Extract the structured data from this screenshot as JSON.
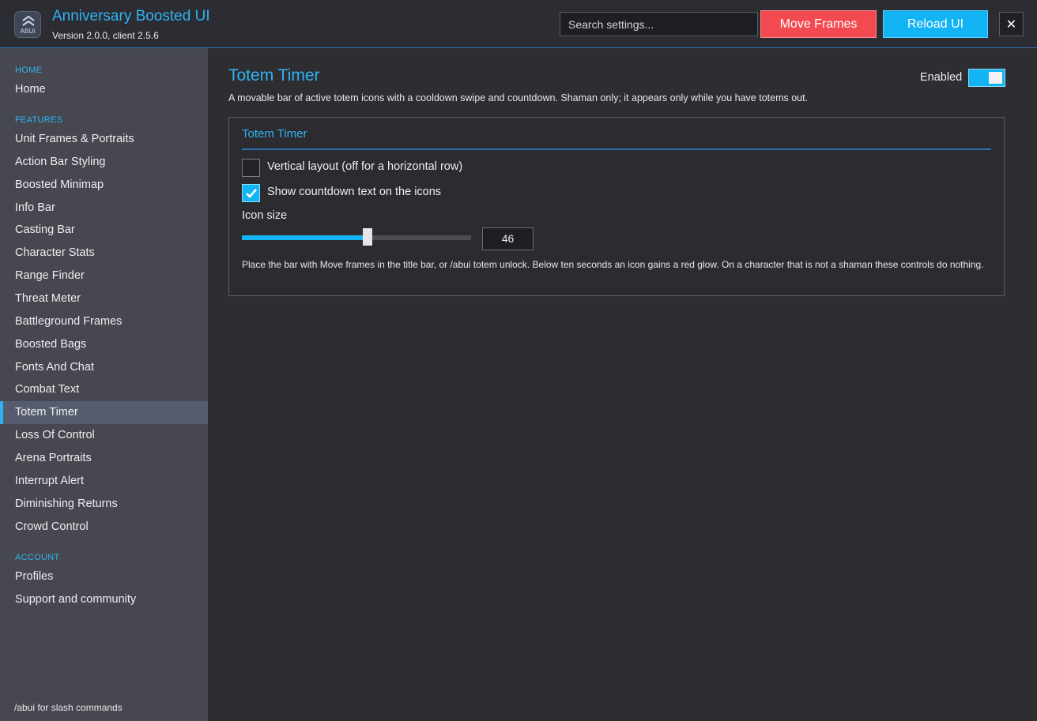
{
  "app": {
    "logo_text": "ABUI",
    "title": "Anniversary Boosted UI",
    "version": "Version 2.0.0, client 2.5.6"
  },
  "header": {
    "search_placeholder": "Search settings...",
    "move_frames_label": "Move Frames",
    "reload_ui_label": "Reload UI",
    "close_label": "✕"
  },
  "sidebar": {
    "sections": [
      {
        "label": "HOME",
        "items": [
          "Home"
        ]
      },
      {
        "label": "FEATURES",
        "items": [
          "Unit Frames & Portraits",
          "Action Bar Styling",
          "Boosted Minimap",
          "Info Bar",
          "Casting Bar",
          "Character Stats",
          "Range Finder",
          "Threat Meter",
          "Battleground Frames",
          "Boosted Bags",
          "Fonts And Chat",
          "Combat Text",
          "Totem Timer",
          "Loss Of Control",
          "Arena Portraits",
          "Interrupt Alert",
          "Diminishing Returns",
          "Crowd Control"
        ]
      },
      {
        "label": "ACCOUNT",
        "items": [
          "Profiles",
          "Support and community"
        ]
      }
    ],
    "active_item": "Totem Timer",
    "footer": "/abui for slash commands"
  },
  "main": {
    "title": "Totem Timer",
    "description": "A movable bar of active totem icons with a cooldown swipe and countdown.  Shaman only; it appears only while you have totems out.",
    "enabled_label": "Enabled",
    "enabled": true,
    "panel": {
      "title": "Totem Timer",
      "options": [
        {
          "label": "Vertical layout (off for a horizontal row)",
          "checked": false
        },
        {
          "label": "Show countdown text on the icons",
          "checked": true
        }
      ],
      "icon_size_label": "Icon size",
      "icon_size_value": "46",
      "icon_size_fraction": 0.547,
      "help": "Place the bar with Move frames in the title bar, or /abui totem unlock.  Below ten seconds an icon gains a red glow.  On a character that is not a shaman these controls do nothing."
    }
  },
  "colors": {
    "accent": "#30b3f2",
    "move_button": "#f24a50",
    "reload_button": "#13b4f4"
  }
}
